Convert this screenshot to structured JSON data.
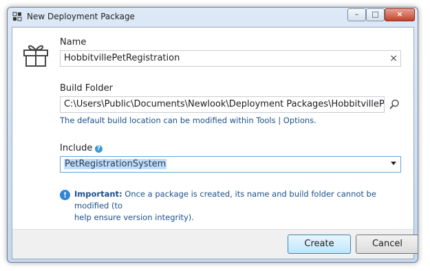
{
  "window": {
    "title": "New Deployment Package",
    "controls": {
      "minimize": "–",
      "maximize": "□",
      "close": "×"
    }
  },
  "icons": {
    "app": "package-icon",
    "gift": "gift-icon",
    "search": "search-icon",
    "help": "help-icon",
    "info": "info-icon"
  },
  "name": {
    "label": "Name",
    "value": "HobbitvillePetRegistration",
    "clear_glyph": "×"
  },
  "build_folder": {
    "label": "Build Folder",
    "value": "C:\\Users\\Public\\Documents\\Newlook\\Deployment Packages\\HobbitvillePet",
    "hint": "The default build location can be modified within Tools | Options."
  },
  "include": {
    "label": "Include",
    "help_glyph": "?",
    "selected": "PetRegistrationSystem"
  },
  "note": {
    "strong": "Important:",
    "text": " Once a package is created, its name and build folder cannot be modified (to",
    "text_line2": "help ensure version integrity)."
  },
  "buttons": {
    "create": "Create",
    "cancel": "Cancel"
  },
  "colors": {
    "accent": "#3a9ad9",
    "hint_text": "#1a4f8a"
  }
}
